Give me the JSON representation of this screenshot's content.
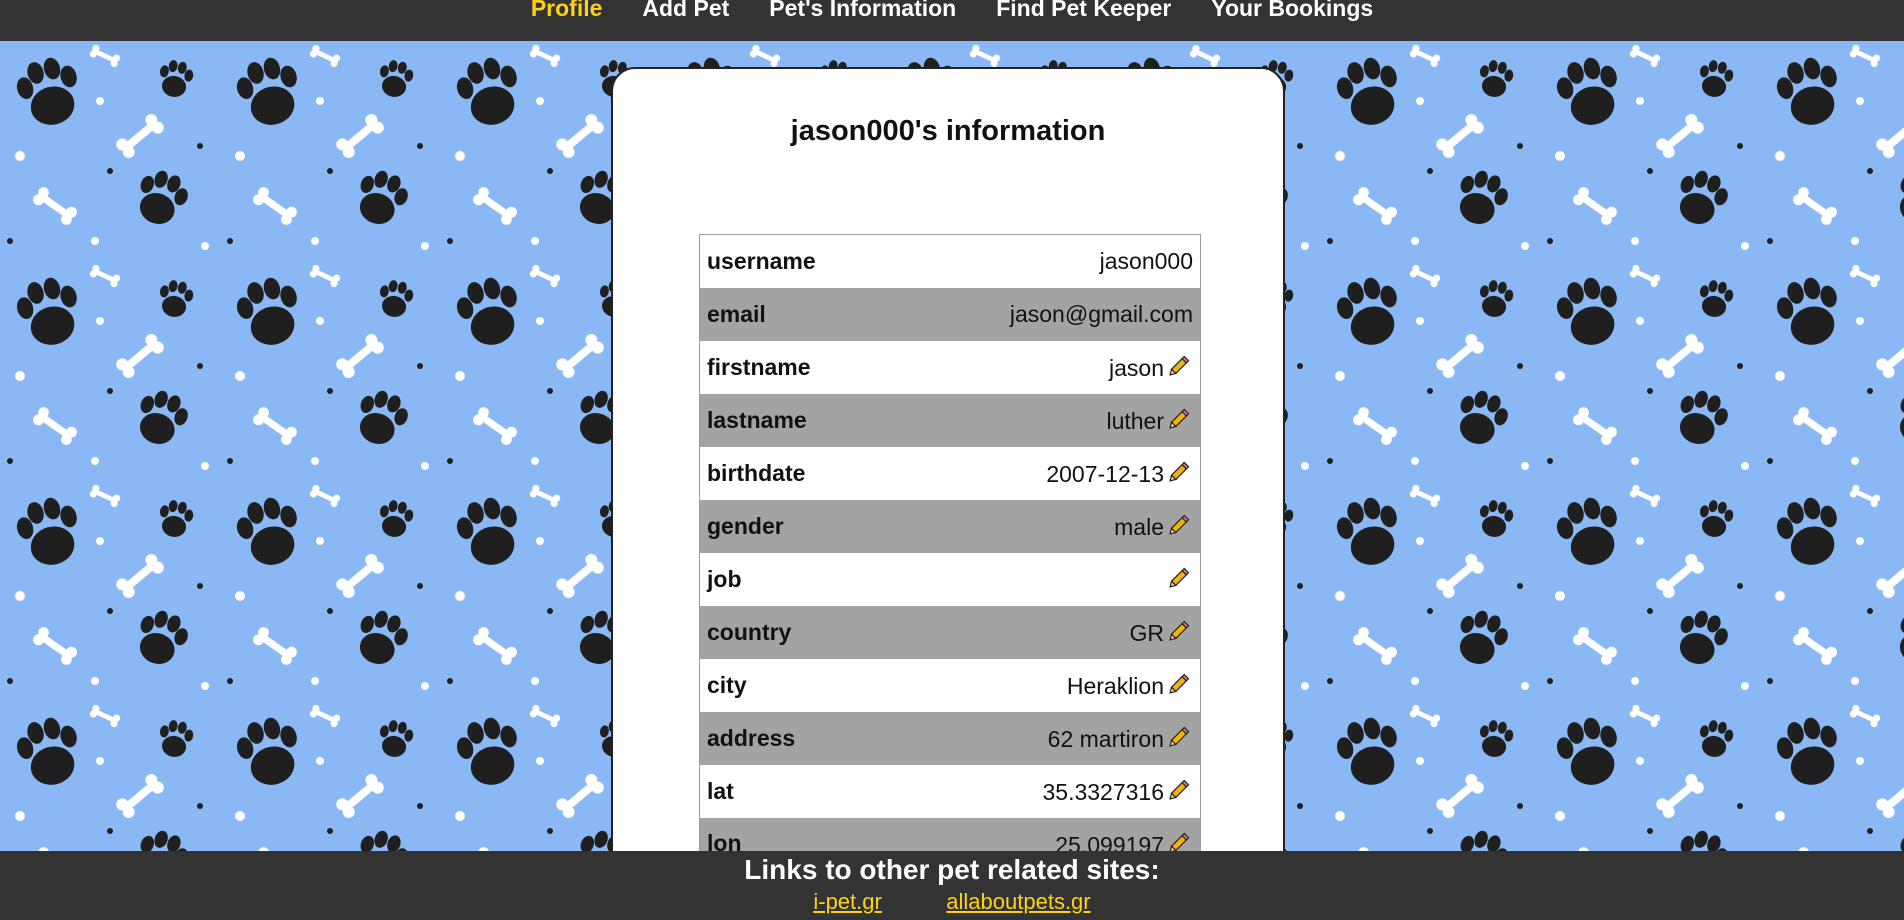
{
  "nav": {
    "items": [
      {
        "label": "Profile",
        "active": true
      },
      {
        "label": "Add Pet",
        "active": false
      },
      {
        "label": "Pet's Information",
        "active": false
      },
      {
        "label": "Find Pet Keeper",
        "active": false
      },
      {
        "label": "Your Bookings",
        "active": false
      }
    ]
  },
  "page": {
    "title": "jason000's information"
  },
  "profile_table": {
    "rows": [
      {
        "key": "username",
        "value": "jason000",
        "editable": false
      },
      {
        "key": "email",
        "value": "jason@gmail.com",
        "editable": false
      },
      {
        "key": "firstname",
        "value": "jason",
        "editable": true
      },
      {
        "key": "lastname",
        "value": "luther",
        "editable": true
      },
      {
        "key": "birthdate",
        "value": "2007-12-13",
        "editable": true
      },
      {
        "key": "gender",
        "value": "male",
        "editable": true
      },
      {
        "key": "job",
        "value": "",
        "editable": true
      },
      {
        "key": "country",
        "value": "GR",
        "editable": true
      },
      {
        "key": "city",
        "value": "Heraklion",
        "editable": true
      },
      {
        "key": "address",
        "value": "62 martiron",
        "editable": true
      },
      {
        "key": "lat",
        "value": "35.3327316",
        "editable": true
      },
      {
        "key": "lon",
        "value": "25.099197",
        "editable": true
      }
    ],
    "edit_icon": "pencil-icon"
  },
  "footer": {
    "title": "Links to other pet related sites:",
    "links": [
      "i-pet.gr",
      "allaboutpets.gr"
    ]
  },
  "colors": {
    "nav_bg": "#333333",
    "nav_active": "#ffd21a",
    "background": "#8ab8f5",
    "row_shade": "#a3a3a3",
    "link": "#ffd21a"
  }
}
